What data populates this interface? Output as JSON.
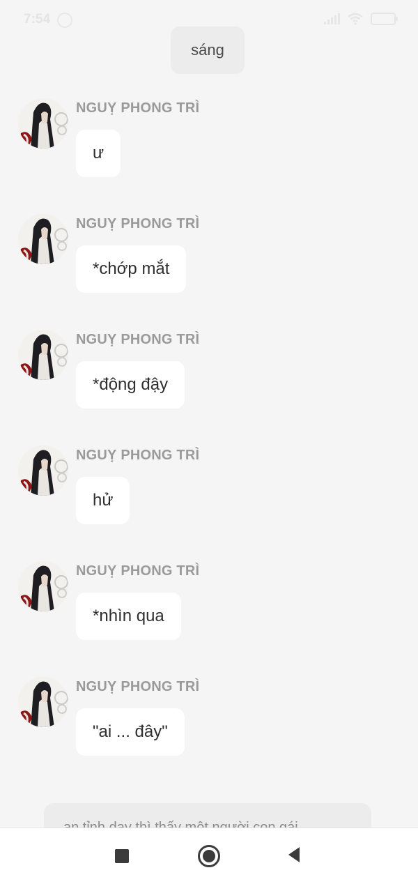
{
  "status_bar": {
    "time": "7:54"
  },
  "user_message": {
    "text": "sáng"
  },
  "messages": [
    {
      "sender": "NGUỴ PHONG TRÌ",
      "text": "ư"
    },
    {
      "sender": "NGUỴ PHONG TRÌ",
      "text": "*chớp mắt"
    },
    {
      "sender": "NGUỴ PHONG TRÌ",
      "text": "*động đậy"
    },
    {
      "sender": "NGUỴ PHONG TRÌ",
      "text": "hử"
    },
    {
      "sender": "NGUỴ PHONG TRÌ",
      "text": "*nhìn qua"
    },
    {
      "sender": "NGUỴ PHONG TRÌ",
      "text": "\"ai ... đây\""
    }
  ],
  "composer": {
    "partial_text": "an tỉnh dạy thì thấy một người con gái"
  },
  "nav_bar": {
    "icons": [
      "recent-apps-icon",
      "home-icon",
      "back-icon"
    ]
  }
}
